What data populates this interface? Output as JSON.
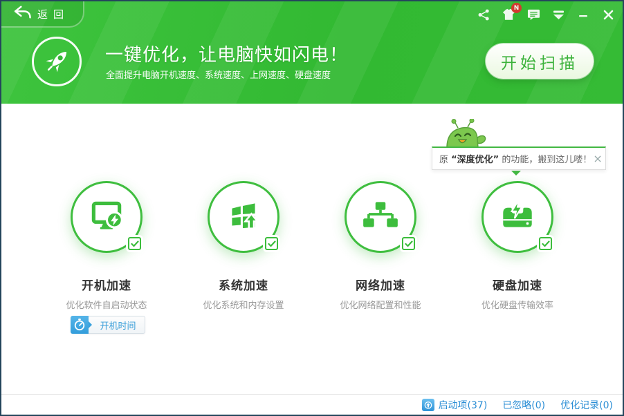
{
  "titlebar": {
    "back_label": "返回",
    "notification_badge": "N"
  },
  "header": {
    "title": "一键优化，让电脑快如闪电！",
    "subtitle": "全面提升电脑开机速度、系统速度、上网速度、硬盘速度",
    "scan_button_label": "开始扫描"
  },
  "tooltip": {
    "prefix": "原 ",
    "highlight": "“深度优化”",
    "suffix": " 的功能，搬到这儿喽！",
    "close_label": "×"
  },
  "modules": [
    {
      "name": "开机加速",
      "desc": "优化软件自启动状态",
      "icon": "monitor-bolt-icon"
    },
    {
      "name": "系统加速",
      "desc": "优化系统和内存设置",
      "icon": "windows-up-icon"
    },
    {
      "name": "网络加速",
      "desc": "优化网络配置和性能",
      "icon": "network-nodes-icon"
    },
    {
      "name": "硬盘加速",
      "desc": "优化硬盘传输效率",
      "icon": "disk-bolt-icon"
    }
  ],
  "boot_time_button_label": "开机时间",
  "footer": {
    "startup_items": "启动项(37)",
    "ignored": "已忽略(0)",
    "records": "优化记录(0)"
  },
  "colors": {
    "brand_green": "#35bb35",
    "icon_green": "#3dbd3d",
    "link_blue": "#2b8ed5",
    "badge_red": "#e03030"
  }
}
